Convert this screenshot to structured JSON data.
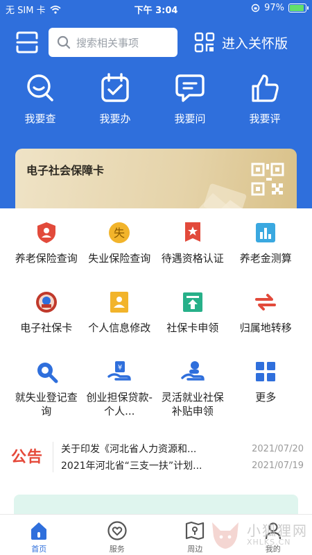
{
  "status_bar": {
    "carrier": "无 SIM 卡",
    "time": "下午 3:04",
    "battery": "97%",
    "battery_level": 0.97
  },
  "topbar": {
    "search_placeholder": "搜索相关事项",
    "care_mode_label": "进入关怀版"
  },
  "quick_actions": [
    {
      "label": "我要查",
      "icon": "search-smile-icon"
    },
    {
      "label": "我要办",
      "icon": "calendar-check-icon"
    },
    {
      "label": "我要问",
      "icon": "chat-bubble-icon"
    },
    {
      "label": "我要评",
      "icon": "thumbs-up-icon"
    }
  ],
  "card": {
    "title": "电子社会保障卡",
    "icon": "qr-code-icon"
  },
  "services": [
    {
      "label": "养老保险查询",
      "icon": "pension-shield-icon",
      "color": "#e24a3b"
    },
    {
      "label": "失业保险查询",
      "icon": "unemployment-badge-icon",
      "color": "#f2b42b"
    },
    {
      "label": "待遇资格认证",
      "icon": "star-document-icon",
      "color": "#e24a3b"
    },
    {
      "label": "养老金测算",
      "icon": "bar-chart-icon",
      "color": "#3aa8e0"
    },
    {
      "label": "电子社保卡",
      "icon": "emblem-icon",
      "color": "#c0392b"
    },
    {
      "label": "个人信息修改",
      "icon": "id-card-icon",
      "color": "#f2b42b"
    },
    {
      "label": "社保卡申领",
      "icon": "card-apply-icon",
      "color": "#27b089"
    },
    {
      "label": "归属地转移",
      "icon": "transfer-arrows-icon",
      "color": "#e24a3b"
    },
    {
      "label": "就失业登记查询",
      "icon": "magnifier-icon",
      "color": "#2f6fdc"
    },
    {
      "label": "创业担保贷款-个人...",
      "icon": "loan-hand-icon",
      "color": "#2f6fdc"
    },
    {
      "label": "灵活就业社保补贴申领",
      "icon": "subsidy-hand-icon",
      "color": "#2f6fdc"
    },
    {
      "label": "更多",
      "icon": "grid-more-icon",
      "color": "#2f6fdc"
    }
  ],
  "notice": {
    "tag": "公告",
    "items": [
      {
        "text": "关于印发《河北省人力资源和...",
        "date": "2021/07/20"
      },
      {
        "text": "2021年河北省“三支一扶”计划...",
        "date": "2021/07/19"
      }
    ]
  },
  "tabs": [
    {
      "label": "首页",
      "icon": "home-icon",
      "active": true
    },
    {
      "label": "服务",
      "icon": "heart-circle-icon",
      "active": false
    },
    {
      "label": "周边",
      "icon": "map-pin-icon",
      "active": false
    },
    {
      "label": "我的",
      "icon": "user-icon",
      "active": false
    }
  ],
  "watermark": {
    "text": "小狐狸网",
    "sub": "XHLKS.CN"
  },
  "colors": {
    "primary": "#2f6fdc",
    "notice_red": "#e5493a"
  }
}
